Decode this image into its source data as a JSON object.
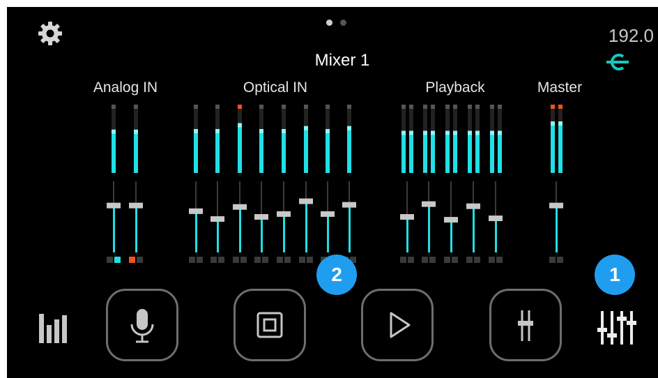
{
  "header": {
    "title": "Mixer 1",
    "sample_rate": "192.0"
  },
  "pagination": {
    "count": 2,
    "active": 0
  },
  "groups": [
    {
      "id": "analog",
      "label": "Analog IN",
      "channels": [
        {
          "level": 0.74,
          "peak": false,
          "fader": 0.66,
          "btn": [
            "mute",
            "solo-on"
          ]
        },
        {
          "level": 0.74,
          "peak": false,
          "fader": 0.66,
          "btn": [
            "mute-on",
            "solo"
          ]
        }
      ]
    },
    {
      "id": "optical",
      "label": "Optical IN",
      "channels": [
        {
          "level": 0.75,
          "peak": false,
          "fader": 0.58
        },
        {
          "level": 0.75,
          "peak": false,
          "fader": 0.47
        },
        {
          "level": 0.85,
          "peak": true,
          "fader": 0.64
        },
        {
          "level": 0.75,
          "peak": false,
          "fader": 0.5
        },
        {
          "level": 0.75,
          "peak": false,
          "fader": 0.54
        },
        {
          "level": 0.8,
          "peak": false,
          "fader": 0.72
        },
        {
          "level": 0.75,
          "peak": false,
          "fader": 0.54
        },
        {
          "level": 0.8,
          "peak": false,
          "fader": 0.67
        }
      ]
    },
    {
      "id": "playback",
      "label": "Playback",
      "channels": [
        {
          "level": 0.72,
          "stereo": true,
          "fader": 0.5
        },
        {
          "level": 0.72,
          "stereo": true,
          "fader": 0.68
        },
        {
          "level": 0.72,
          "stereo": true,
          "fader": 0.46
        },
        {
          "level": 0.72,
          "stereo": true,
          "fader": 0.65
        },
        {
          "level": 0.72,
          "stereo": true,
          "fader": 0.48
        }
      ]
    },
    {
      "id": "master",
      "label": "Master",
      "channels": [
        {
          "level": 0.88,
          "stereo": true,
          "peak": true,
          "fader": 0.66
        }
      ]
    }
  ],
  "colors": {
    "meter": "#1fe0e6",
    "peak": "#f2541b",
    "badge": "#1f9ef0",
    "track": "#3a3a3a",
    "cap": "#c8c8c8"
  },
  "icons": {
    "settings": "gear-icon",
    "sync": "sync-link-icon",
    "meters": "level-meters-icon",
    "mixer": "mixer-sliders-icon"
  },
  "bottom_nav": [
    {
      "id": "mic",
      "icon": "microphone-icon"
    },
    {
      "id": "screen",
      "icon": "square-target-icon"
    },
    {
      "id": "play",
      "icon": "play-icon"
    },
    {
      "id": "fader",
      "icon": "single-fader-icon"
    }
  ],
  "badges": {
    "one": "1",
    "two": "2"
  }
}
